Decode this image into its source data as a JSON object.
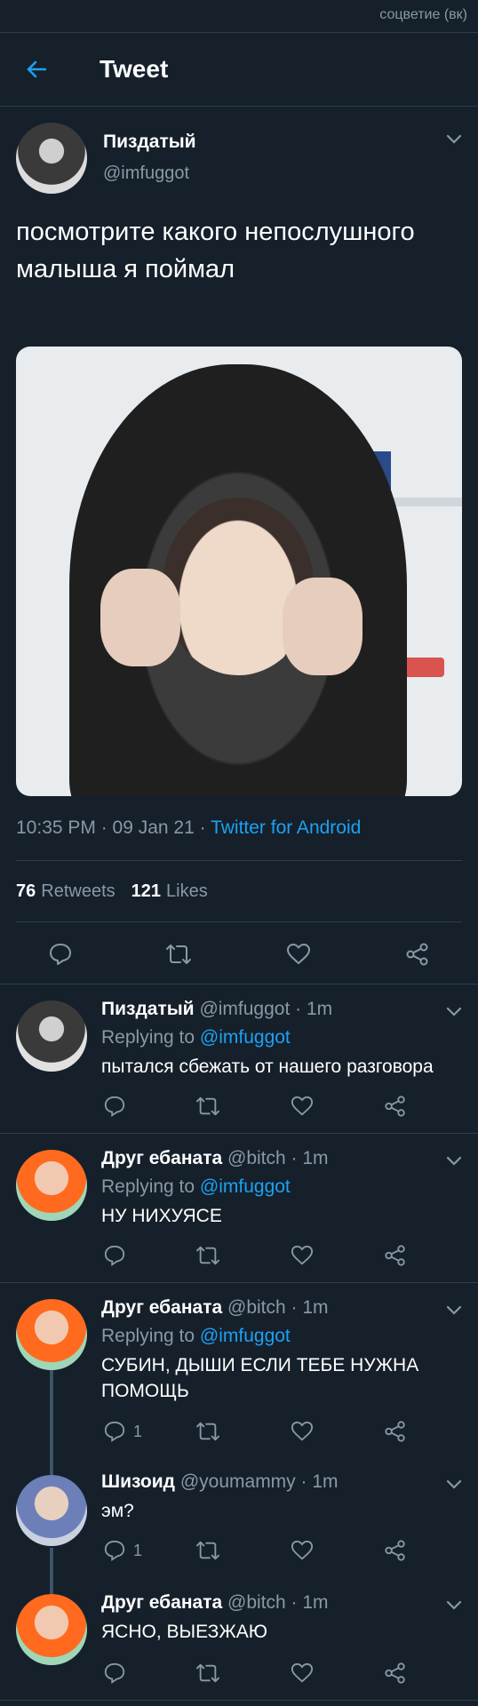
{
  "watermark": "соцветие (вк)",
  "header": {
    "title": "Tweet",
    "back_icon": "arrow-left-icon"
  },
  "main_tweet": {
    "name": "Пиздатый",
    "handle": "@imfuggot",
    "text": "посмотрите какого непослушного малыша я поймал",
    "time": "10:35 PM · 09 Jan 21 · ",
    "source": "Twitter for Android",
    "retweets": "76",
    "retweets_label": "Retweets",
    "likes": "121",
    "likes_label": "Likes"
  },
  "replies": [
    {
      "name": "Пиздатый",
      "handle": "@imfuggot · 1m",
      "replying_prefix": "Replying to ",
      "replying_to": "@imfuggot",
      "text": "пытался сбежать от нашего разговора",
      "reply_count": ""
    },
    {
      "name": "Друг ебаната",
      "handle": "@bitch · 1m",
      "replying_prefix": "Replying to ",
      "replying_to": "@imfuggot",
      "text": "НУ НИХУЯСЕ",
      "reply_count": ""
    },
    {
      "name": "Друг ебаната",
      "handle": "@bitch · 1m",
      "replying_prefix": "Replying to ",
      "replying_to": "@imfuggot",
      "text": "СУБИН, ДЫШИ ЕСЛИ ТЕБЕ НУЖНА ПОМОЩЬ",
      "reply_count": "1"
    },
    {
      "name": "Шизоид",
      "handle": "@youmammy · 1m",
      "text": "эм?",
      "reply_count": "1"
    },
    {
      "name": "Друг ебаната",
      "handle": "@bitch · 1m",
      "text": "ЯСНО, ВЫЕЗЖАЮ",
      "reply_count": ""
    }
  ],
  "colors": {
    "background": "#15202b",
    "accent": "#1da1f2",
    "muted": "#8899a6",
    "border": "#2f3d4c"
  }
}
